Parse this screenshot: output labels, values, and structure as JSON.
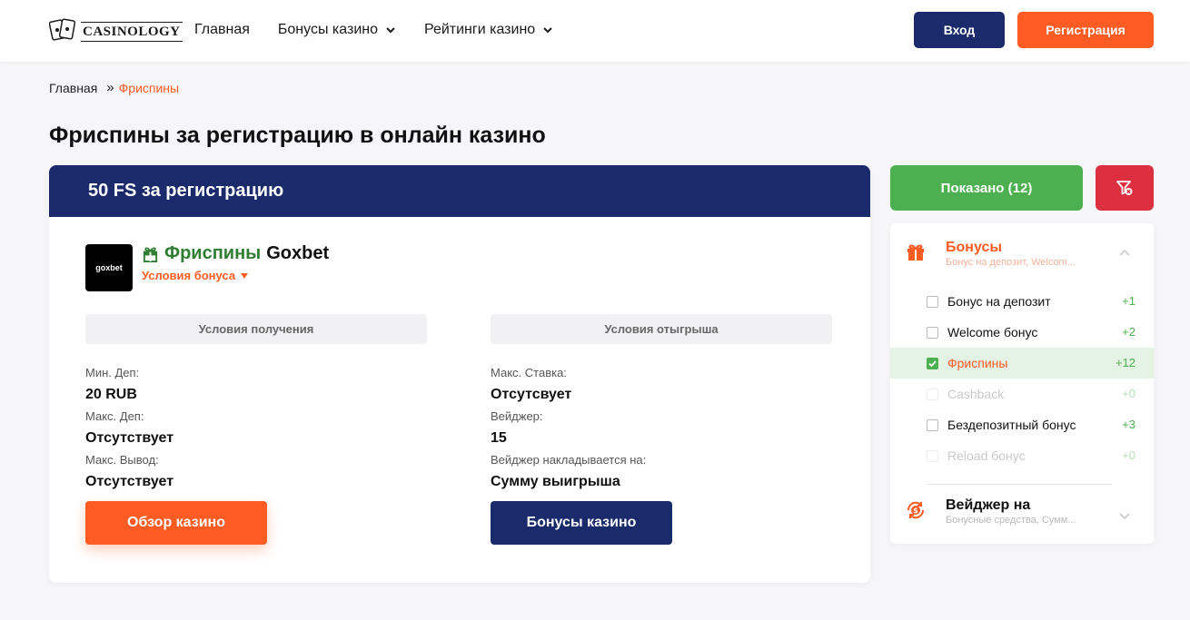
{
  "header": {
    "logo_text": "CASINOLOGY",
    "nav": [
      {
        "label": "Главная",
        "has_dropdown": false
      },
      {
        "label": "Бонусы казино",
        "has_dropdown": true
      },
      {
        "label": "Рейтинги казино",
        "has_dropdown": true
      }
    ],
    "login_label": "Вход",
    "register_label": "Регистрация"
  },
  "breadcrumb": {
    "home": "Главная",
    "separator": "»",
    "current": "Фриспины"
  },
  "page_title": "Фриспины за регистрацию в онлайн казино",
  "bonus_card": {
    "header_title": "50 FS за регистрацию",
    "casino_logo_text": "goxbet",
    "bonus_type": "Фриспины",
    "casino_name": "Goxbet",
    "conditions_link": "Условия бонуса",
    "receive_section": {
      "title": "Условия получения",
      "items": [
        {
          "label": "Мин. Деп:",
          "value": "20 RUB"
        },
        {
          "label": "Макс. Деп:",
          "value": "Отсутствует"
        },
        {
          "label": "Макс. Вывод:",
          "value": "Отсутствует"
        }
      ]
    },
    "wager_section": {
      "title": "Условия отыгрыша",
      "items": [
        {
          "label": "Макс. Ставка:",
          "value": "Отсутсвует"
        },
        {
          "label": "Вейджер:",
          "value": "15"
        },
        {
          "label": "Вейджер накладывается на:",
          "value": "Сумму выигрыша"
        }
      ]
    },
    "review_button": "Обзор казино",
    "bonuses_button": "Бонусы казино"
  },
  "sidebar": {
    "shown_button": "Показано (12)",
    "filter_groups": [
      {
        "title": "Бонусы",
        "subtitle": "Бонус на депозит, Welcom...",
        "expanded": true,
        "options": [
          {
            "label": "Бонус на депозит",
            "count": "+1",
            "checked": false,
            "disabled": false
          },
          {
            "label": "Welcome бонус",
            "count": "+2",
            "checked": false,
            "disabled": false
          },
          {
            "label": "Фриспины",
            "count": "+12",
            "checked": true,
            "disabled": false
          },
          {
            "label": "Cashback",
            "count": "+0",
            "checked": false,
            "disabled": true
          },
          {
            "label": "Бездепозитный бонус",
            "count": "+3",
            "checked": false,
            "disabled": false
          },
          {
            "label": "Reload бонус",
            "count": "+0",
            "checked": false,
            "disabled": true
          }
        ]
      },
      {
        "title": "Вейджер на",
        "subtitle": "Бонусные средства, Сумм...",
        "expanded": false
      }
    ]
  },
  "colors": {
    "brand_navy": "#1b2a6b",
    "accent_orange": "#ff5c24",
    "success_green": "#4caf50",
    "danger_red": "#dc2f3f"
  },
  "icons": [
    "playing-cards-icon",
    "chevron-down-icon",
    "gift-icon",
    "filter-reset-icon",
    "chevron-up-icon",
    "coin-cycle-icon",
    "check-icon"
  ]
}
